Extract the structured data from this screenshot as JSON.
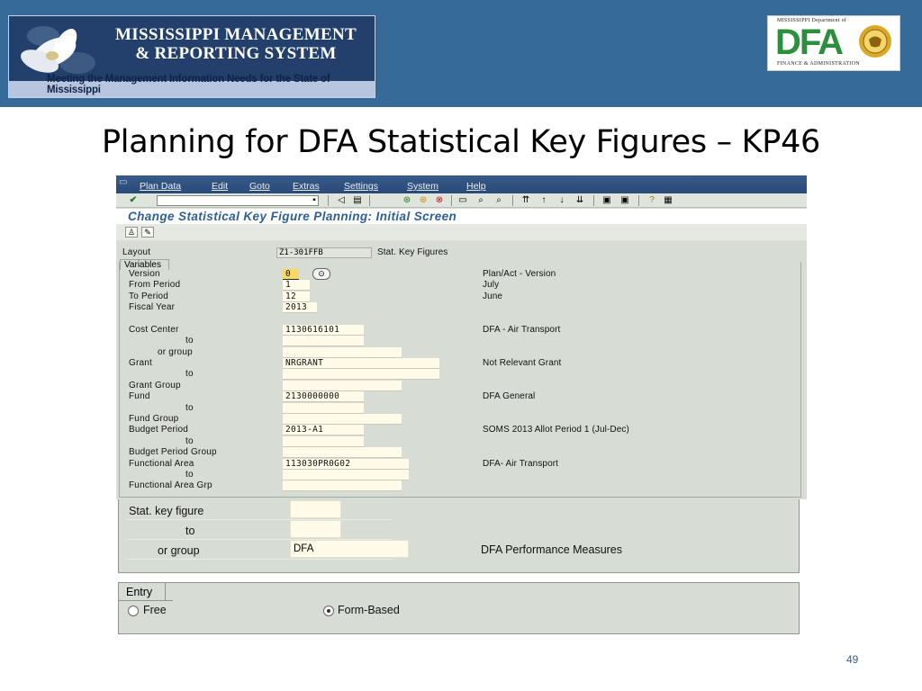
{
  "header": {
    "banner_line1": "MISSISSIPPI MANAGEMENT",
    "banner_line2": "& REPORTING SYSTEM",
    "banner_tagline": "Meeting the Management Information Needs for the State of Mississippi",
    "logo_dept": "MISSISSIPPI Department of",
    "logo_text": "DFA",
    "logo_sub": "FINANCE & ADMINISTRATION",
    "band_color": "#356a99"
  },
  "slide_title": "Planning for DFA Statistical Key Figures – KP46",
  "sap": {
    "menu": [
      "Plan Data",
      "Edit",
      "Goto",
      "Extras",
      "Settings",
      "System",
      "Help"
    ],
    "screen_title": "Change Statistical Key Figure Planning: Initial Screen",
    "layout_label": "Layout",
    "layout_value": "Z1-301FFB",
    "layout_desc": "Stat. Key Figures",
    "variables_tab": "Variables",
    "rows": [
      {
        "label": "Version",
        "value": "0",
        "desc": "Plan/Act - Version"
      },
      {
        "label": "From Period",
        "value": "1",
        "desc": "July"
      },
      {
        "label": "To Period",
        "value": "12",
        "desc": "June"
      },
      {
        "label": "Fiscal Year",
        "value": "2013",
        "desc": ""
      },
      {
        "label": "Cost Center",
        "value": "1130616101",
        "desc": "DFA - Air Transport"
      },
      {
        "label": "to",
        "value": "",
        "desc": ""
      },
      {
        "label": "or group",
        "value": "",
        "desc": ""
      },
      {
        "label": "Grant",
        "value": "NRGRANT",
        "desc": "Not Relevant Grant"
      },
      {
        "label": "to",
        "value": "",
        "desc": ""
      },
      {
        "label": "Grant Group",
        "value": "",
        "desc": ""
      },
      {
        "label": "Fund",
        "value": "2130000000",
        "desc": "DFA General"
      },
      {
        "label": "to",
        "value": "",
        "desc": ""
      },
      {
        "label": "Fund Group",
        "value": "",
        "desc": ""
      },
      {
        "label": "Budget Period",
        "value": "2013-A1",
        "desc": "SOMS 2013 Allot Period 1 (Jul-Dec)"
      },
      {
        "label": "to",
        "value": "",
        "desc": ""
      },
      {
        "label": "Budget Period Group",
        "value": "",
        "desc": ""
      },
      {
        "label": "Functional Area",
        "value": "113030PR0G02",
        "desc": "DFA- Air Transport"
      },
      {
        "label": "to",
        "value": "",
        "desc": ""
      },
      {
        "label": "Functional Area Grp",
        "value": "",
        "desc": ""
      }
    ]
  },
  "lower": {
    "stat_key_figure_label": "Stat. key figure",
    "stat_key_figure_value": "",
    "to_label": "to",
    "to_value": "",
    "or_group_label": "or group",
    "or_group_value": "DFA",
    "or_group_desc": "DFA Performance Measures"
  },
  "entry": {
    "tab": "Entry",
    "free_label": "Free",
    "form_based_label": "Form-Based",
    "selected": "Form-Based"
  },
  "page_number": "49"
}
